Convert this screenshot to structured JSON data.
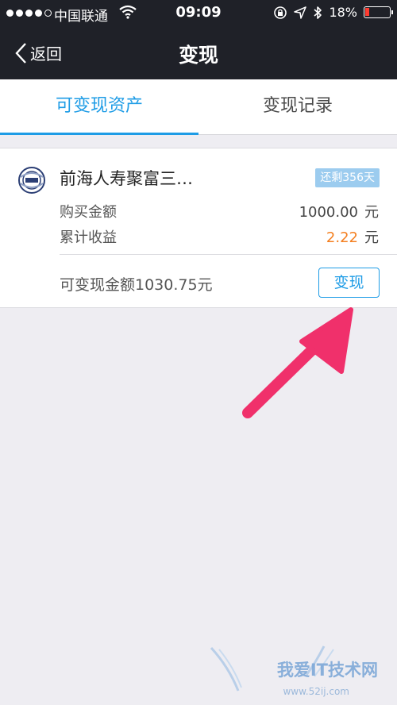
{
  "status_bar": {
    "carrier": "中国联通",
    "time": "09:09",
    "battery_percent": "18%",
    "battery_level": 0.18
  },
  "nav": {
    "back_label": "返回",
    "title": "变现"
  },
  "tabs": [
    {
      "label": "可变现资产",
      "active": true
    },
    {
      "label": "变现记录",
      "active": false
    }
  ],
  "asset_card": {
    "product_name": "前海人寿聚富三…",
    "remaining_badge": "还剩356天",
    "purchase_label": "购买金额",
    "purchase_amount": "1000.00",
    "purchase_unit": "元",
    "earnings_label": "累计收益",
    "earnings_amount": "2.22",
    "earnings_unit": "元",
    "available_text": "可变现金额1030.75元",
    "cash_button_label": "变现"
  },
  "colors": {
    "accent": "#1e9ce6",
    "earnings": "#f47f20",
    "arrow": "#f0306b",
    "topbar": "#1f2128"
  },
  "watermark": {
    "text": "我爱IT技术网",
    "url": "www.52ij.com"
  }
}
